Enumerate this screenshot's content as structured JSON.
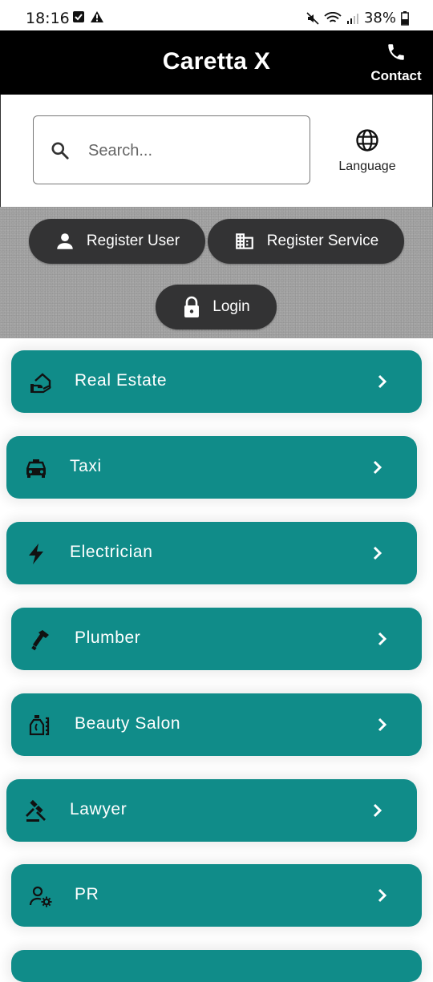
{
  "status_bar": {
    "time": "18:16",
    "battery": "38%"
  },
  "header": {
    "title": "Caretta X",
    "contact_label": "Contact"
  },
  "search": {
    "placeholder": "Search...",
    "value": "",
    "language_label": "Language"
  },
  "auth": {
    "register_user_label": "Register User",
    "register_service_label": "Register Service",
    "login_label": "Login"
  },
  "categories": [
    {
      "label": "Real Estate",
      "icon": "real-estate-icon"
    },
    {
      "label": "Taxi",
      "icon": "taxi-icon"
    },
    {
      "label": "Electrician",
      "icon": "bolt-icon"
    },
    {
      "label": "Plumber",
      "icon": "wrench-icon"
    },
    {
      "label": "Beauty Salon",
      "icon": "cosmetics-icon"
    },
    {
      "label": "Lawyer",
      "icon": "gavel-icon"
    },
    {
      "label": "PR",
      "icon": "person-settings-icon"
    }
  ],
  "colors": {
    "accent": "#108c89",
    "app_bar": "#000000",
    "pill": "#333334",
    "auth_background": "#a3a3a3"
  }
}
